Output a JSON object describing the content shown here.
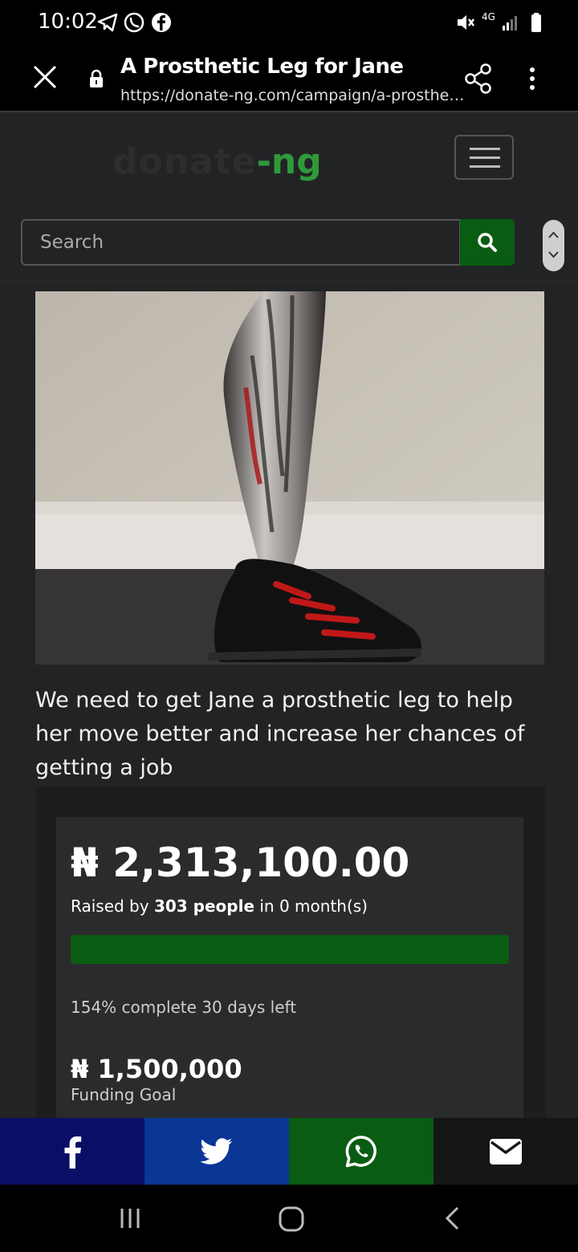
{
  "status_bar": {
    "time": "10:02",
    "network": "4G",
    "icons": [
      "telegram-icon",
      "whatsapp-icon",
      "facebook-icon",
      "mute-icon",
      "signal-icon",
      "battery-icon"
    ]
  },
  "browser": {
    "page_title": "A Prosthetic Leg for Jane",
    "url": "https://donate-ng.com/campaign/a-prosthetic..."
  },
  "site": {
    "logo_part1": "donate",
    "logo_part2": "-ng",
    "brand_color": "#2e9a3a"
  },
  "search": {
    "placeholder": "Search",
    "button_color": "#0a5c12"
  },
  "campaign": {
    "description": "We need to get Jane a prosthetic leg to help her move better and increase her chances of getting a job",
    "amount_raised": "₦ 2,313,100.00",
    "raised_prefix": "Raised by ",
    "donors": "303 people",
    "raised_suffix": " in 0 month(s)",
    "progress_fraction": 1.0,
    "completion_text": "154% complete 30 days left",
    "goal_amount": "₦ 1,500,000",
    "goal_label": "Funding Goal"
  },
  "share_bar": [
    {
      "name": "facebook",
      "icon": "facebook-icon",
      "color": "#0a0f66"
    },
    {
      "name": "twitter",
      "icon": "twitter-icon",
      "color": "#0a3694"
    },
    {
      "name": "whatsapp",
      "icon": "whatsapp-icon",
      "color": "#0a5c12"
    },
    {
      "name": "email",
      "icon": "mail-icon",
      "color": "#151617"
    }
  ]
}
